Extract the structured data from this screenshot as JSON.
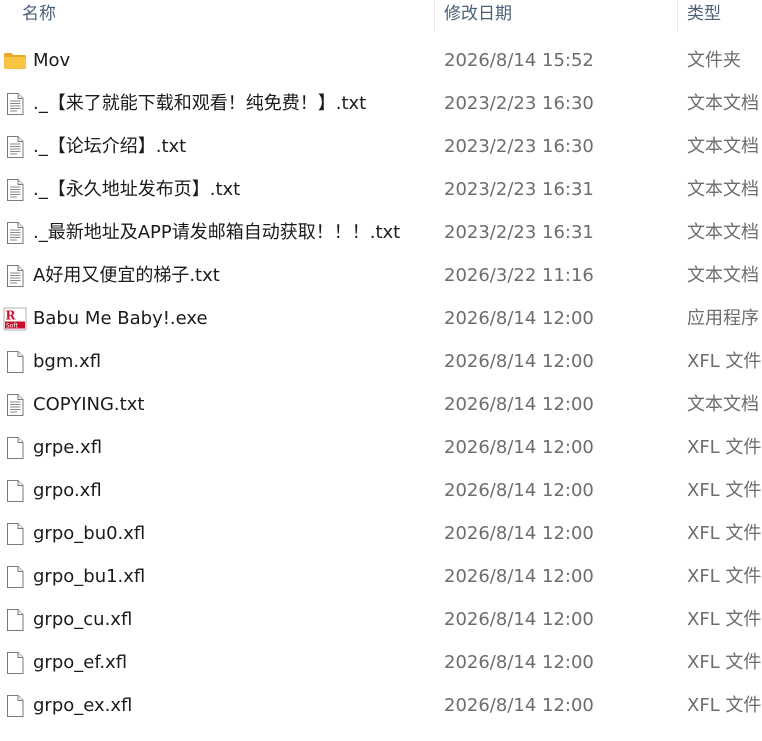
{
  "header": {
    "name": "名称",
    "date": "修改日期",
    "type": "类型"
  },
  "files": [
    {
      "icon": "folder-icon",
      "name": "Mov",
      "date": "2026/8/14 15:52",
      "type": "文件夹"
    },
    {
      "icon": "text-file-icon",
      "name": "._【来了就能下载和观看！纯免费！】.txt",
      "date": "2023/2/23 16:30",
      "type": "文本文档"
    },
    {
      "icon": "text-file-icon",
      "name": "._【论坛介绍】.txt",
      "date": "2023/2/23 16:30",
      "type": "文本文档"
    },
    {
      "icon": "text-file-icon",
      "name": "._【永久地址发布页】.txt",
      "date": "2023/2/23 16:31",
      "type": "文本文档"
    },
    {
      "icon": "text-file-icon",
      "name": "._最新地址及APP请发邮箱自动获取！！！.txt",
      "date": "2023/2/23 16:31",
      "type": "文本文档"
    },
    {
      "icon": "text-file-icon",
      "name": "A好用又便宜的梯子.txt",
      "date": "2026/3/22 11:16",
      "type": "文本文档"
    },
    {
      "icon": "app-icon",
      "name": "Babu Me Baby!.exe",
      "date": "2026/8/14 12:00",
      "type": "应用程序"
    },
    {
      "icon": "blank-file-icon",
      "name": "bgm.xfl",
      "date": "2026/8/14 12:00",
      "type": "XFL 文件"
    },
    {
      "icon": "text-file-icon",
      "name": "COPYING.txt",
      "date": "2026/8/14 12:00",
      "type": "文本文档"
    },
    {
      "icon": "blank-file-icon",
      "name": "grpe.xfl",
      "date": "2026/8/14 12:00",
      "type": "XFL 文件"
    },
    {
      "icon": "blank-file-icon",
      "name": "grpo.xfl",
      "date": "2026/8/14 12:00",
      "type": "XFL 文件"
    },
    {
      "icon": "blank-file-icon",
      "name": "grpo_bu0.xfl",
      "date": "2026/8/14 12:00",
      "type": "XFL 文件"
    },
    {
      "icon": "blank-file-icon",
      "name": "grpo_bu1.xfl",
      "date": "2026/8/14 12:00",
      "type": "XFL 文件"
    },
    {
      "icon": "blank-file-icon",
      "name": "grpo_cu.xfl",
      "date": "2026/8/14 12:00",
      "type": "XFL 文件"
    },
    {
      "icon": "blank-file-icon",
      "name": "grpo_ef.xfl",
      "date": "2026/8/14 12:00",
      "type": "XFL 文件"
    },
    {
      "icon": "blank-file-icon",
      "name": "grpo_ex.xfl",
      "date": "2026/8/14 12:00",
      "type": "XFL 文件"
    }
  ],
  "app_icon_text": "R Soft",
  "colors": {
    "header_text": "#4c607a",
    "name_text": "#1b1b1b",
    "meta_text": "#6d6d6d",
    "folder": "#f6c343",
    "app_icon_red": "#c8102e"
  }
}
